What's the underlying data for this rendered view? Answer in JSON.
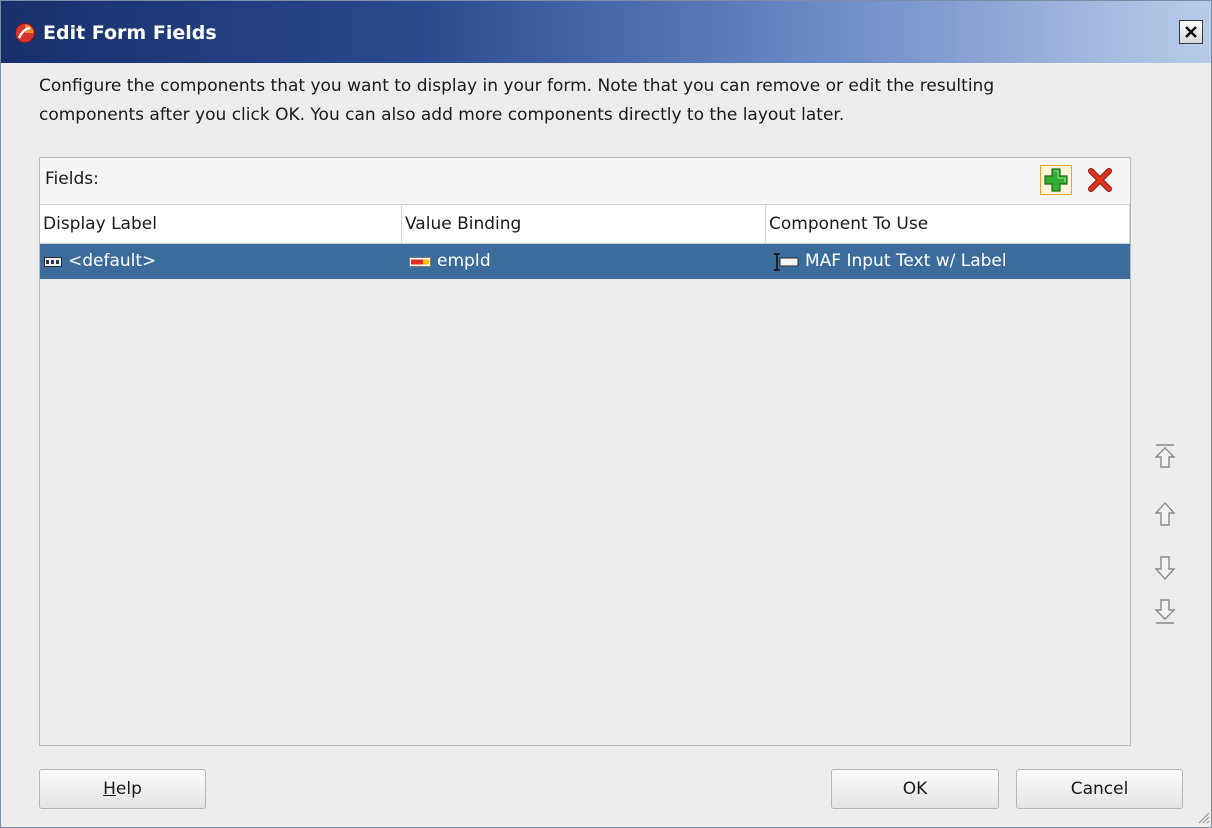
{
  "dialog": {
    "title": "Edit Form Fields",
    "title_icon": "oracle-jdeveloper-icon",
    "close_icon": "close-icon"
  },
  "intro": {
    "line1": "Configure the components that you want to display in your form.  Note that you can remove or edit the resulting",
    "line2": "components after you click OK.  You can also add more components directly to the layout later."
  },
  "fields": {
    "label": "Fields:",
    "add_icon": "add-icon",
    "delete_icon": "delete-icon",
    "columns": [
      "Display Label",
      "Value Binding",
      "Component To Use"
    ],
    "rows": [
      {
        "display_label": "<default>",
        "display_icon": "xyz-label-icon",
        "value_binding": "empId",
        "value_icon": "attribute-icon",
        "component": "MAF Input Text w/ Label",
        "component_icon": "input-text-icon",
        "selected": true
      }
    ]
  },
  "reorder": {
    "top_icon": "move-to-top-icon",
    "up_icon": "move-up-icon",
    "down_icon": "move-down-icon",
    "bottom_icon": "move-to-bottom-icon"
  },
  "buttons": {
    "help": "Help",
    "help_mnemonic": "H",
    "help_rest": "elp",
    "ok": "OK",
    "cancel": "Cancel"
  },
  "colors": {
    "title_gradient_start": "#17306b",
    "title_gradient_end": "#b9cbe9",
    "selection": "#3c6c9c",
    "background": "#ececec"
  }
}
